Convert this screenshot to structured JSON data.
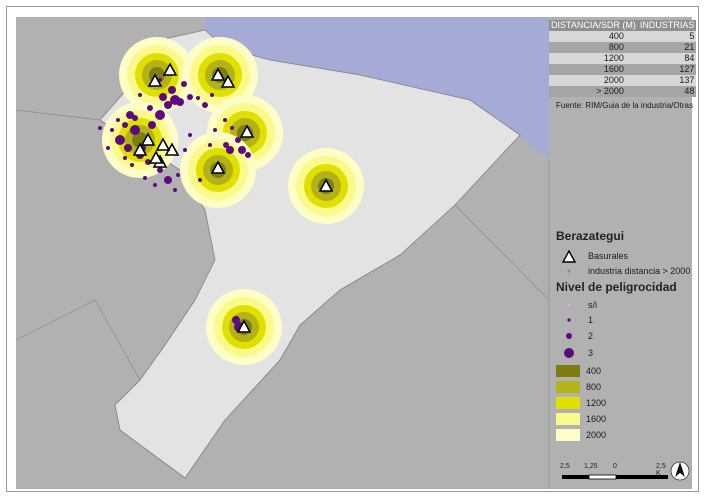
{
  "table": {
    "headers": [
      "DISTANCIA/SDR (M)",
      "INDUSTRIAS"
    ],
    "rows": [
      {
        "distancia": "400",
        "industrias": "5"
      },
      {
        "distancia": "800",
        "industrias": "21"
      },
      {
        "distancia": "1200",
        "industrias": "84"
      },
      {
        "distancia": "1600",
        "industrias": "127"
      },
      {
        "distancia": "2000",
        "industrias": "137"
      },
      {
        "distancia": "> 2000",
        "industrias": "48"
      }
    ],
    "source": "Fuente: RIM/Guia de la industria/Otras"
  },
  "legend": {
    "title": "Berazategui",
    "basurales": "Basurales",
    "industria_lejana": "industria distancia > 2000",
    "nivel_title": "Nivel de peligrocidad",
    "niveles": [
      "s/i",
      "1",
      "2",
      "3"
    ],
    "buffers": [
      {
        "label": "400",
        "color": "#7d7d12"
      },
      {
        "label": "800",
        "color": "#b3b319"
      },
      {
        "label": "1200",
        "color": "#e0e000"
      },
      {
        "label": "1600",
        "color": "#fafa8c"
      },
      {
        "label": "2000",
        "color": "#fdfdc8"
      }
    ]
  },
  "scale": {
    "labels": [
      "2,5",
      "1,25",
      "0",
      "2,5 K"
    ]
  },
  "colors": {
    "water": "#a5abd6",
    "neighbor": "#b1b1b1",
    "district": "#e3e3e3",
    "industry": "#5c0a7e"
  }
}
